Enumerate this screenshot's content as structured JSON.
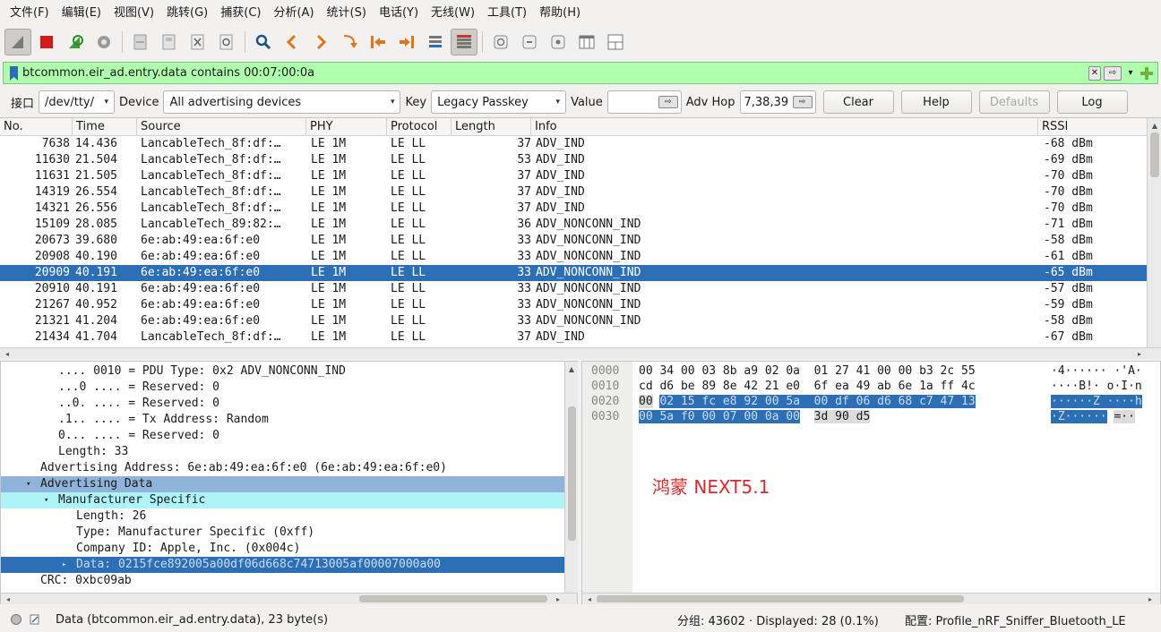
{
  "menu": [
    "文件(F)",
    "编辑(E)",
    "视图(V)",
    "跳转(G)",
    "捕获(C)",
    "分析(A)",
    "统计(S)",
    "电话(Y)",
    "无线(W)",
    "工具(T)",
    "帮助(H)"
  ],
  "toolbar_icons": [
    "shark-fin-start-icon",
    "stop-capture-icon",
    "restart-capture-icon",
    "capture-options-icon",
    "open-file-icon",
    "save-file-icon",
    "close-file-icon",
    "reload-file-icon",
    "find-packet-icon",
    "go-back-icon",
    "go-forward-icon",
    "go-to-packet-icon",
    "go-first-icon",
    "go-last-icon",
    "autoscroll-icon",
    "colorize-icon",
    "zoom-in-icon",
    "zoom-out-icon",
    "normal-size-icon",
    "resize-columns-icon",
    "layout-icon"
  ],
  "filter": {
    "value": "btcommon.eir_ad.entry.data contains 00:07:00:0a",
    "bg_color": "#afffaf"
  },
  "sniffer": {
    "interface_label": "接口",
    "interface_value": "/dev/tty/",
    "device_label": "Device",
    "device_value": "All advertising devices",
    "key_label": "Key",
    "key_value": "Legacy Passkey",
    "value_label": "Value",
    "value_input": "",
    "advhop_label": "Adv Hop",
    "advhop_value": "7,38,39",
    "clear": "Clear",
    "help": "Help",
    "defaults": "Defaults",
    "log": "Log"
  },
  "columns": [
    "No.",
    "Time",
    "Source",
    "PHY",
    "Protocol",
    "Length",
    "Info",
    "RSSI"
  ],
  "packets": [
    {
      "no": "7638",
      "time": "14.436",
      "source": "LancableTech_8f:df:…",
      "phy": "LE 1M",
      "protocol": "LE LL",
      "length": "37",
      "info": "ADV_IND",
      "rssi": "-68 dBm"
    },
    {
      "no": "11630",
      "time": "21.504",
      "source": "LancableTech_8f:df:…",
      "phy": "LE 1M",
      "protocol": "LE LL",
      "length": "53",
      "info": "ADV_IND",
      "rssi": "-69 dBm"
    },
    {
      "no": "11631",
      "time": "21.505",
      "source": "LancableTech_8f:df:…",
      "phy": "LE 1M",
      "protocol": "LE LL",
      "length": "37",
      "info": "ADV_IND",
      "rssi": "-70 dBm"
    },
    {
      "no": "14319",
      "time": "26.554",
      "source": "LancableTech_8f:df:…",
      "phy": "LE 1M",
      "protocol": "LE LL",
      "length": "37",
      "info": "ADV_IND",
      "rssi": "-70 dBm"
    },
    {
      "no": "14321",
      "time": "26.556",
      "source": "LancableTech_8f:df:…",
      "phy": "LE 1M",
      "protocol": "LE LL",
      "length": "37",
      "info": "ADV_IND",
      "rssi": "-70 dBm"
    },
    {
      "no": "15109",
      "time": "28.085",
      "source": "LancableTech_89:82:…",
      "phy": "LE 1M",
      "protocol": "LE LL",
      "length": "36",
      "info": "ADV_NONCONN_IND",
      "rssi": "-71 dBm"
    },
    {
      "no": "20673",
      "time": "39.680",
      "source": "6e:ab:49:ea:6f:e0",
      "phy": "LE 1M",
      "protocol": "LE LL",
      "length": "33",
      "info": "ADV_NONCONN_IND",
      "rssi": "-58 dBm"
    },
    {
      "no": "20908",
      "time": "40.190",
      "source": "6e:ab:49:ea:6f:e0",
      "phy": "LE 1M",
      "protocol": "LE LL",
      "length": "33",
      "info": "ADV_NONCONN_IND",
      "rssi": "-61 dBm"
    },
    {
      "no": "20909",
      "time": "40.191",
      "source": "6e:ab:49:ea:6f:e0",
      "phy": "LE 1M",
      "protocol": "LE LL",
      "length": "33",
      "info": "ADV_NONCONN_IND",
      "rssi": "-65 dBm",
      "selected": true
    },
    {
      "no": "20910",
      "time": "40.191",
      "source": "6e:ab:49:ea:6f:e0",
      "phy": "LE 1M",
      "protocol": "LE LL",
      "length": "33",
      "info": "ADV_NONCONN_IND",
      "rssi": "-57 dBm"
    },
    {
      "no": "21267",
      "time": "40.952",
      "source": "6e:ab:49:ea:6f:e0",
      "phy": "LE 1M",
      "protocol": "LE LL",
      "length": "33",
      "info": "ADV_NONCONN_IND",
      "rssi": "-59 dBm"
    },
    {
      "no": "21321",
      "time": "41.204",
      "source": "6e:ab:49:ea:6f:e0",
      "phy": "LE 1M",
      "protocol": "LE LL",
      "length": "33",
      "info": "ADV_NONCONN_IND",
      "rssi": "-58 dBm"
    },
    {
      "no": "21434",
      "time": "41.704",
      "source": "LancableTech_8f:df:…",
      "phy": "LE 1M",
      "protocol": "LE LL",
      "length": "37",
      "info": "ADV_IND",
      "rssi": "-67 dBm"
    }
  ],
  "details": [
    {
      "text": ".... 0010 = PDU Type: 0x2 ADV_NONCONN_IND",
      "indent": 3,
      "style": ""
    },
    {
      "text": "...0 .... = Reserved: 0",
      "indent": 3,
      "style": ""
    },
    {
      "text": "..0. .... = Reserved: 0",
      "indent": 3,
      "style": ""
    },
    {
      "text": ".1.. .... = Tx Address: Random",
      "indent": 3,
      "style": ""
    },
    {
      "text": "0... .... = Reserved: 0",
      "indent": 3,
      "style": ""
    },
    {
      "text": "Length: 33",
      "indent": 3,
      "style": ""
    },
    {
      "text": "Advertising Address: 6e:ab:49:ea:6f:e0 (6e:ab:49:ea:6f:e0)",
      "indent": 2,
      "style": ""
    },
    {
      "text": "Advertising Data",
      "indent": 2,
      "style": "hl",
      "twisty": "▾"
    },
    {
      "text": "Manufacturer Specific",
      "indent": 3,
      "style": "hl2",
      "twisty": "▾"
    },
    {
      "text": "Length: 26",
      "indent": 4,
      "style": ""
    },
    {
      "text": "Type: Manufacturer Specific (0xff)",
      "indent": 4,
      "style": ""
    },
    {
      "text": "Company ID: Apple, Inc. (0x004c)",
      "indent": 4,
      "style": ""
    },
    {
      "text": "Data: 0215fce892005a00df06d668c74713005af00007000a00",
      "indent": 4,
      "style": "sel",
      "twisty": "▸"
    },
    {
      "text": "CRC: 0xbc09ab",
      "indent": 2,
      "style": ""
    }
  ],
  "hex": {
    "offsets": [
      "0000",
      "0010",
      "0020",
      "0030"
    ],
    "line0": "00 34 00 03 8b a9 02 0a  01 27 41 00 00 b3 2c 55",
    "line1": "cd d6 be 89 8e 42 21 e0  6f ea 49 ab 6e 1a ff 4c",
    "line2_a": "00",
    "line2_b": "02 15 fc e8 92 00 5a  00 df 06 d6 68 c7 47 13",
    "line3_b": "00 5a f0 00 07 00 0a 00",
    "line3_c": "3d 90 d5",
    "ascii0": "·4······ ·'A·",
    "ascii1": "····B!· o·I·n",
    "ascii2": "······Z ····h",
    "ascii3a": "·Z······",
    "ascii3b": "=··"
  },
  "overlay_text": "鸿蒙 NEXT5.1",
  "status": {
    "field": "Data (btcommon.eir_ad.entry.data), 23 byte(s)",
    "packets": "分组: 43602 · Displayed: 28 (0.1%)",
    "profile": "配置: Profile_nRF_Sniffer_Bluetooth_LE"
  }
}
